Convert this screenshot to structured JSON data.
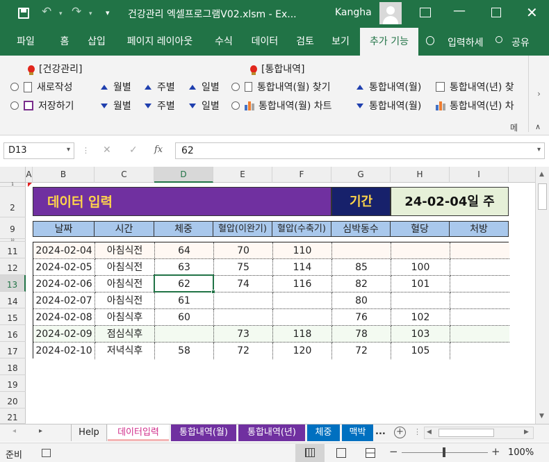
{
  "title_bar": {
    "file_title": "건강관리 엑셀프로그램V02.xlsm  -  Ex...",
    "user_name": "Kangha",
    "customize_label": "▾"
  },
  "ribbon_tabs": [
    "파일",
    "홈",
    "삽입",
    "페이지 레이아웃",
    "수식",
    "데이터",
    "검토",
    "보기",
    "추가 기능"
  ],
  "tell_me": "입력하세",
  "share_label": "공유",
  "ribbon": {
    "group1_title": "[건강관리]",
    "group2_title": "[통합내역]",
    "new_label": "새로작성",
    "save_label": "저장하기",
    "monthly": "월별",
    "weekly": "주별",
    "daily": "일별",
    "find_monthly": "통합내역(월) 찾기",
    "chart_monthly": "통합내역(월) 차트",
    "up_monthly": "통합내역(월)",
    "down_monthly": "통합내역(월)",
    "year_find": "통합내역(년) 찾",
    "year_chart": "통합내역(년) 차",
    "more_label": "메"
  },
  "formula_bar": {
    "name_box": "D13",
    "fx_label": "fx",
    "value": "62"
  },
  "columns": [
    "A",
    "B",
    "C",
    "D",
    "E",
    "F",
    "G",
    "H",
    "I"
  ],
  "rows": [
    "1",
    "2",
    "9",
    "10",
    "11",
    "12",
    "13",
    "14",
    "15",
    "16",
    "17",
    "18",
    "19",
    "20",
    "21"
  ],
  "banner": {
    "title": "데이터 입력",
    "period_label": "기간",
    "period_value": "24-02-04일 주"
  },
  "table": {
    "headers": [
      "날짜",
      "시간",
      "체중",
      "혈압(이완기)",
      "혈압(수축기)",
      "심박동수",
      "혈당",
      "처방"
    ],
    "rows": [
      [
        "2024-02-04",
        "아침식전",
        "64",
        "70",
        "110",
        "",
        "",
        ""
      ],
      [
        "2024-02-05",
        "아침식전",
        "63",
        "75",
        "114",
        "85",
        "100",
        ""
      ],
      [
        "2024-02-06",
        "아침식전",
        "62",
        "74",
        "116",
        "82",
        "101",
        ""
      ],
      [
        "2024-02-07",
        "아침식전",
        "61",
        "",
        "",
        "80",
        "",
        ""
      ],
      [
        "2024-02-08",
        "아침식후",
        "60",
        "",
        "",
        "76",
        "102",
        ""
      ],
      [
        "2024-02-09",
        "점심식후",
        "",
        "73",
        "118",
        "78",
        "103",
        ""
      ],
      [
        "2024-02-10",
        "저녁식후",
        "58",
        "72",
        "120",
        "72",
        "105",
        ""
      ]
    ]
  },
  "sheet_tabs": [
    "Help",
    "데이터입력",
    "통합내역(월)",
    "통합내역(년)",
    "체중",
    "맥박"
  ],
  "sheet_more": "...",
  "status": {
    "ready": "준비",
    "zoom": "100%"
  },
  "colors": {
    "excel_green": "#217346",
    "banner_purple": "#7030a0",
    "banner_title": "#ffd54a",
    "period_navy": "#17216b",
    "period_value_bg": "#e6f0d8",
    "header_blue": "#a9c8ec"
  }
}
